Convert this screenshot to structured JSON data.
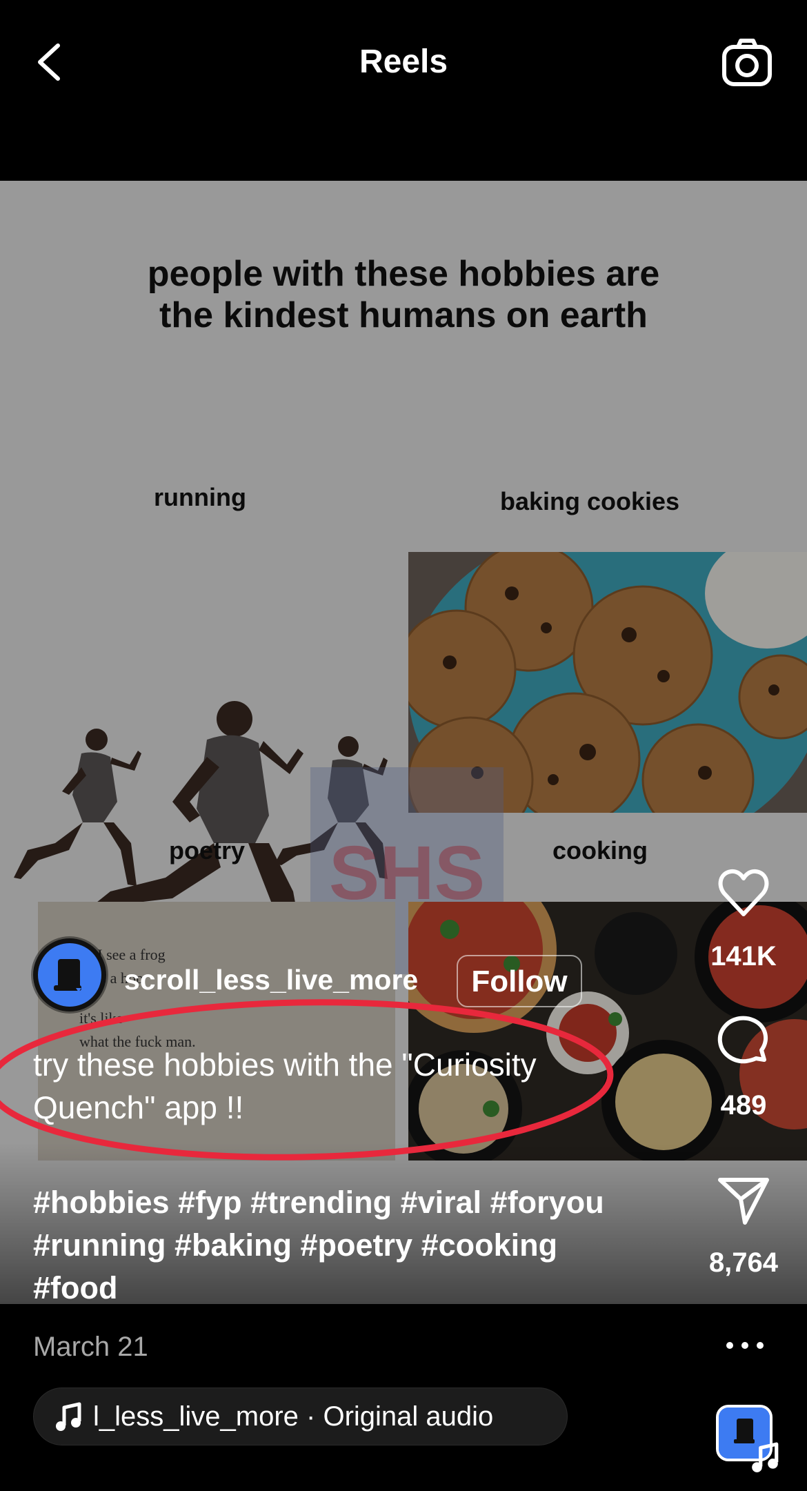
{
  "header": {
    "title": "Reels",
    "back_icon": "chevron-left-icon",
    "camera_icon": "camera-icon"
  },
  "post": {
    "headline_line1": "people with these hobbies are",
    "headline_line2": "the kindest humans on earth",
    "labels": {
      "running": "running",
      "baking": "baking cookies",
      "poetry": "poetry",
      "cooking": "cooking"
    },
    "poem_lines": [
      "en I see a frog",
      "akes a hop",
      "it's like",
      "what the fuck man."
    ],
    "watermark": "SHS",
    "username": "scroll_less_live_more",
    "follow_label": "Follow",
    "caption_line1": "try these hobbies with the \"Curiosity",
    "caption_line2": "Quench\" app !!",
    "hashtags_line1": "#hobbies #fyp #trending #viral #foryou",
    "hashtags_line2": "#running #baking #poetry #cooking",
    "hashtags_line3": "#food",
    "annotation_color": "#e8283c"
  },
  "actions": {
    "likes": "141K",
    "comments": "489",
    "shares": "8,764"
  },
  "footer": {
    "date": "March 21",
    "audio_text": "l_less_live_more · Original audio",
    "audio_icon": "music-note-icon",
    "more_icon": "more-horizontal-icon"
  },
  "colors": {
    "background": "#000000",
    "video_bg": "#e8e8e8",
    "avatar": "#3d7bf2",
    "secondary_text": "#a8a8a8"
  }
}
